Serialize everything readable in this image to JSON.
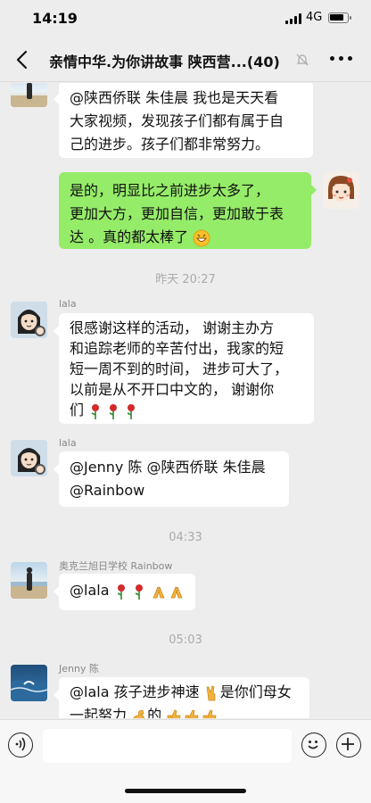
{
  "status_bar": {
    "time": "14:19",
    "network": "4G"
  },
  "nav": {
    "title": "亲情中华.为你讲故事 陕西营...",
    "member_count": "(40)"
  },
  "messages": [
    {
      "id": "m1",
      "side": "left",
      "avatar": "beach-photo-avatar",
      "sender": "",
      "lines": [
        "@陕西侨联 朱佳晨 我也是天天看",
        "大家视频，发现孩子们都有属于自",
        "己的进步。孩子们都非常努力。"
      ]
    },
    {
      "id": "m2",
      "side": "right",
      "avatar": "cartoon-girl-avatar",
      "lines": [
        "是的，明显比之前进步太多了，",
        "更加大方，更加自信，更加敢于表",
        "达 。真的都太棒了"
      ],
      "emoji": "grin-emoji"
    },
    {
      "id": "t1",
      "type": "time",
      "text": "昨天 20:27"
    },
    {
      "id": "m3",
      "side": "left",
      "avatar": "lala-avatar",
      "sender": "lala",
      "lines": [
        "很感谢这样的活动， 谢谢主办方",
        "和追踪老师的辛苦付出，我家的短",
        "短一周不到的时间， 进步可大了，",
        " 以前是从不开口中文的， 谢谢你",
        "们"
      ],
      "emoji": "rose-emoji"
    },
    {
      "id": "m4",
      "side": "left",
      "avatar": "lala-avatar",
      "sender": "lala",
      "lines": [
        "@Jenny 陈 @陕西侨联 朱佳晨",
        "@Rainbow"
      ]
    },
    {
      "id": "t2",
      "type": "time",
      "text": "04:33"
    },
    {
      "id": "m5",
      "side": "left",
      "avatar": "beach-photo-avatar",
      "sender": "奥克兰旭日学校 Rainbow",
      "lines": [
        "@lala "
      ],
      "emoji": "rose-and-pray-emoji"
    },
    {
      "id": "t3",
      "type": "time",
      "text": "05:03"
    },
    {
      "id": "m6",
      "side": "left",
      "avatar": "ocean-avatar",
      "sender": "Jenny 陈",
      "lines": [
        "@lala 孩子进步神速",
        "是你们母女",
        "一起努力",
        "的"
      ]
    }
  ],
  "input_bar": {
    "placeholder": ""
  },
  "colors": {
    "background": "#ededed",
    "self_bubble": "#95ec69",
    "other_bubble": "#ffffff",
    "rose": "#d42a2a"
  }
}
